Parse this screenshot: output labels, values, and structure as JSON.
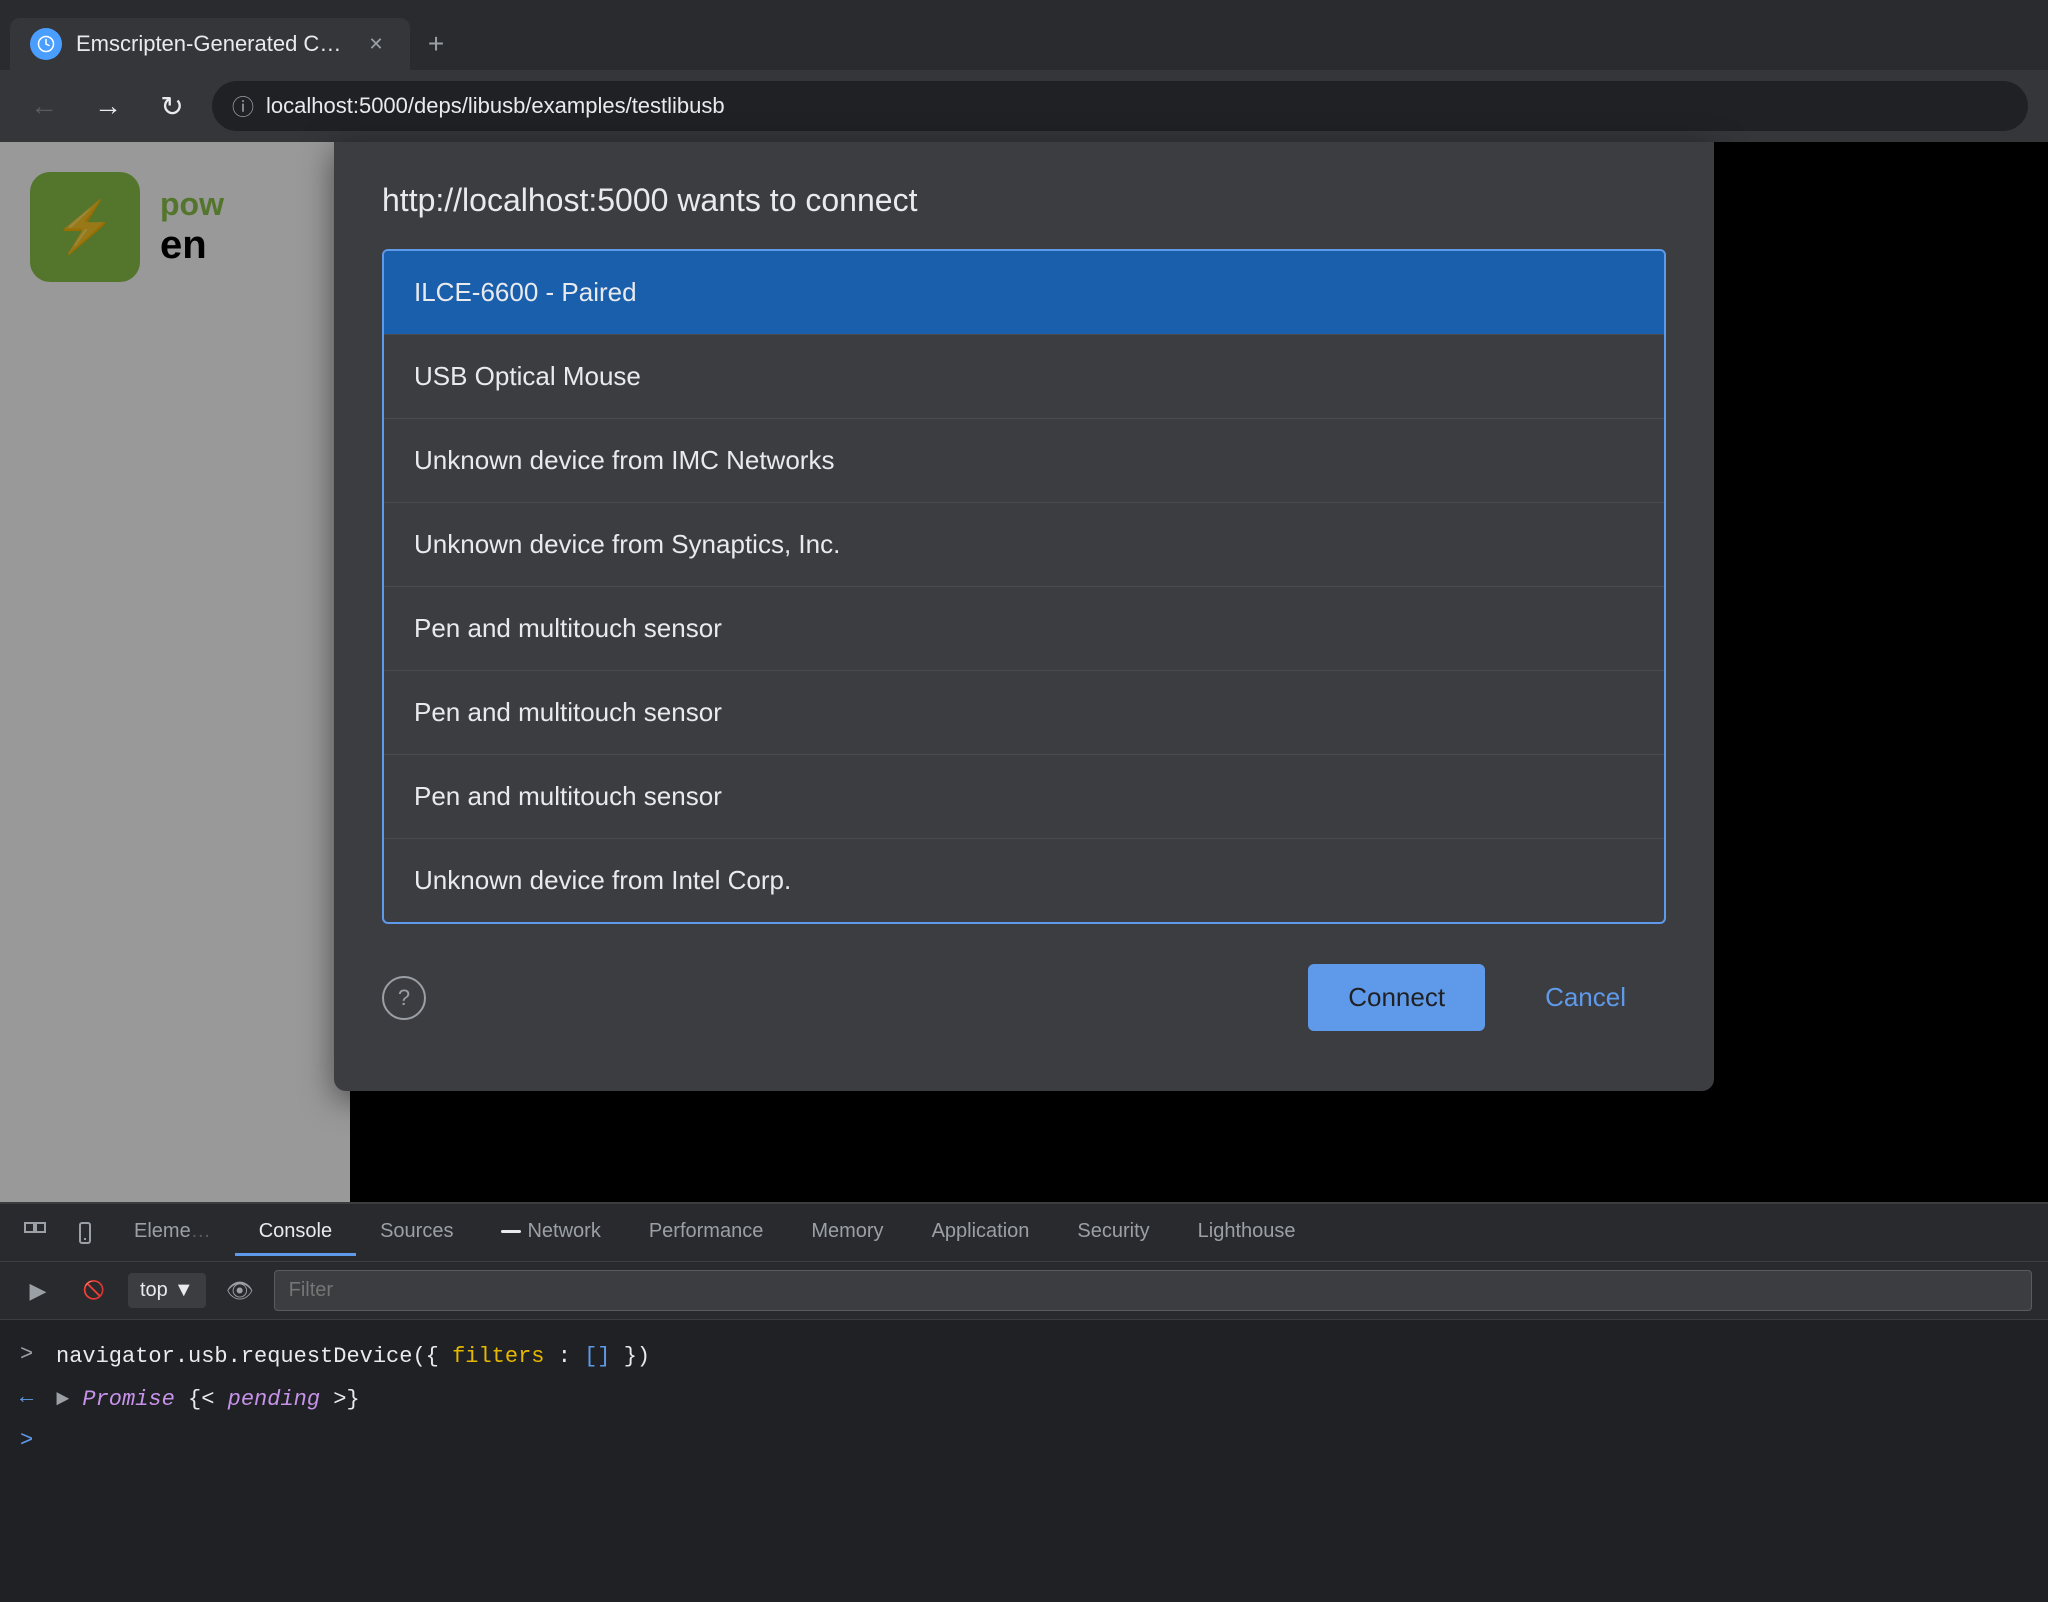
{
  "browser": {
    "tab_title": "Emscripten-Generated Code",
    "address": "localhost:5000/deps/libusb/examples/testlibusb",
    "new_tab_label": "+"
  },
  "dialog": {
    "title": "http://localhost:5000 wants to connect",
    "devices": [
      {
        "name": "ILCE-6600 - Paired",
        "selected": true
      },
      {
        "name": "USB Optical Mouse",
        "selected": false
      },
      {
        "name": "Unknown device from IMC Networks",
        "selected": false
      },
      {
        "name": "Unknown device from Synaptics, Inc.",
        "selected": false
      },
      {
        "name": "Pen and multitouch sensor",
        "selected": false,
        "index": 0
      },
      {
        "name": "Pen and multitouch sensor",
        "selected": false,
        "index": 1
      },
      {
        "name": "Pen and multitouch sensor",
        "selected": false,
        "index": 2
      },
      {
        "name": "Unknown device from Intel Corp.",
        "selected": false
      }
    ],
    "connect_label": "Connect",
    "cancel_label": "Cancel"
  },
  "devtools": {
    "tabs": [
      {
        "label": "Elements",
        "active": false
      },
      {
        "label": "Console",
        "active": true
      },
      {
        "label": "Sources",
        "active": false
      },
      {
        "label": "Network",
        "active": false
      },
      {
        "label": "Performance",
        "active": false
      },
      {
        "label": "Memory",
        "active": false
      },
      {
        "label": "Application",
        "active": false
      },
      {
        "label": "Security",
        "active": false
      },
      {
        "label": "Lighthouse",
        "active": false
      }
    ],
    "console_bar": {
      "top_label": "top",
      "filter_placeholder": "Filter"
    },
    "console_lines": [
      {
        "arrow": ">",
        "arrow_color": "gray",
        "text": "navigator.usb.requestDevice({ filters: [] })"
      },
      {
        "arrow": "←",
        "arrow_color": "blue",
        "text": "▶ Promise {<pending>}"
      }
    ],
    "prompt": ">"
  },
  "page": {
    "app_name_pow": "pow",
    "app_name_en": "en"
  }
}
